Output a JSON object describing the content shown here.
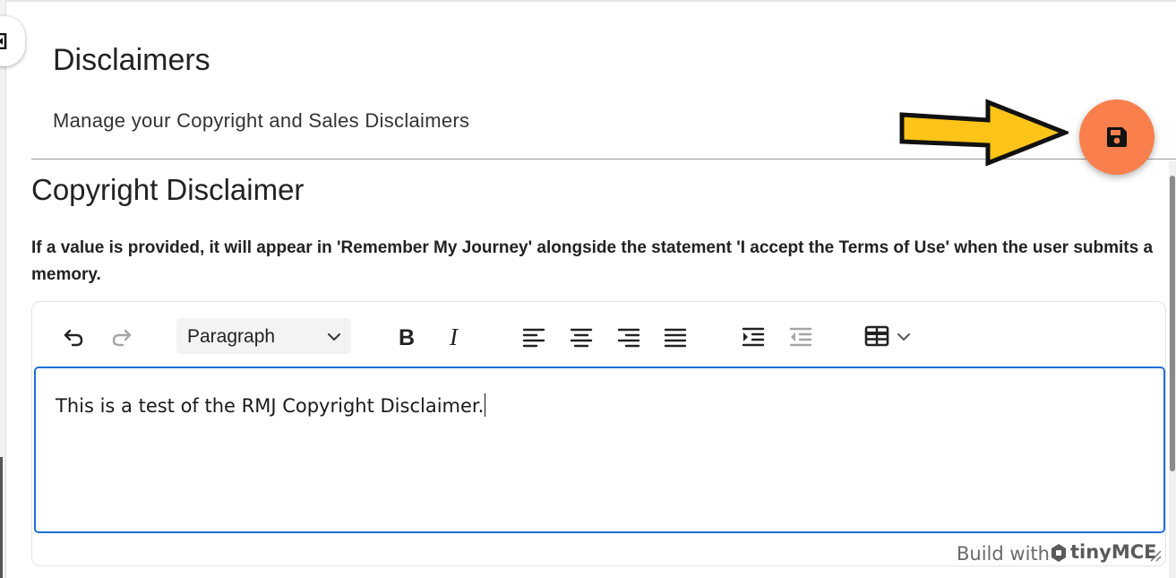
{
  "header": {
    "title": "Disclaimers",
    "subtitle": "Manage your Copyright and Sales Disclaimers"
  },
  "actions": {
    "save_icon": "floppy-disk-icon",
    "save_color": "#f9804c",
    "arrow_color": "#fcc419"
  },
  "section": {
    "title": "Copyright Disclaimer",
    "notice": "If a value is provided, it will appear in 'Remember My Journey' alongside the statement 'I accept the Terms of Use' when the user submits a memory."
  },
  "editor": {
    "toolbar": {
      "undo_icon": "undo-icon",
      "redo_icon": "redo-icon",
      "block_format": "Paragraph",
      "bold_icon": "bold-icon",
      "italic_icon": "italic-icon",
      "align_left_icon": "align-left-icon",
      "align_center_icon": "align-center-icon",
      "align_right_icon": "align-right-icon",
      "justify_icon": "justify-icon",
      "indent_icon": "indent-icon",
      "outdent_icon": "outdent-icon",
      "table_icon": "table-icon"
    },
    "content": "This is a test of the RMJ Copyright Disclaimer.",
    "branding_prefix": "Build with",
    "branding_name": "tinyMCE",
    "focus_color": "#1d6fd6"
  }
}
